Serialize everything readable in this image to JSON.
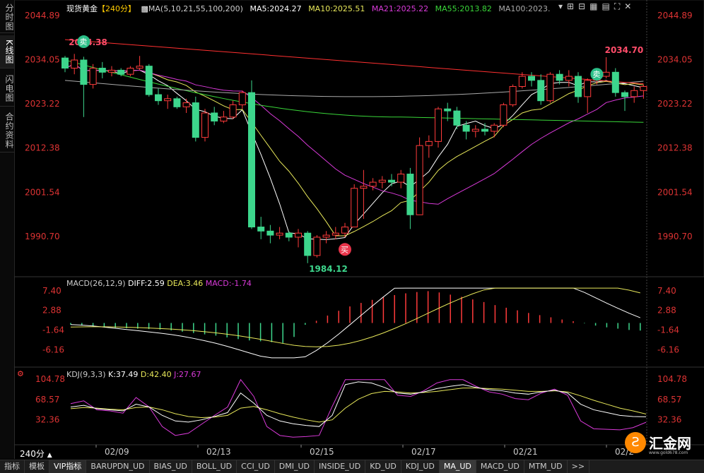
{
  "sidebar": {
    "tabs": [
      {
        "label": "分时图",
        "active": false
      },
      {
        "label": "K线图",
        "active": true
      },
      {
        "label": "闪电图",
        "active": false
      },
      {
        "label": "合约资料",
        "active": false
      }
    ]
  },
  "main_panel": {
    "symbol": "现货黄金",
    "period": "【240分】",
    "ma_spec": "MA(5,10,21,55,100,200)",
    "ma5": "MA5:2024.27",
    "ma10": "MA10:2025.51",
    "ma21": "MA21:2025.22",
    "ma55": "MA55:2013.82",
    "ma100": "MA100:2023.",
    "y_ticks": [
      "2044.89",
      "2034.05",
      "2023.22",
      "2012.38",
      "2001.54",
      "1990.70"
    ],
    "high_label": "2034.70",
    "high_label_left": "2034.38",
    "low_label": "1984.12",
    "sell_badge": "卖",
    "buy_badge": "买"
  },
  "macd_panel": {
    "title": "MACD(26,12,9)",
    "diff": "DIFF:2.59",
    "dea": "DEA:3.46",
    "macd": "MACD:-1.74",
    "y_ticks": [
      "7.40",
      "2.88",
      "-1.64",
      "-6.16"
    ]
  },
  "kdj_panel": {
    "title": "KDJ(9,3,3)",
    "k": "K:37.49",
    "d": "D:42.40",
    "j": "J:27.67",
    "y_ticks": [
      "104.78",
      "68.57",
      "32.36"
    ]
  },
  "x_axis": {
    "dates": [
      "02/09",
      "02/13",
      "02/15",
      "02/17",
      "02/21",
      "02/2"
    ]
  },
  "period_badge": "240分",
  "bottom_tabs": [
    "指标",
    "模板",
    "VIP指标",
    "BARUPDN_UD",
    "BIAS_UD",
    "BOLL_UD",
    "CCI_UD",
    "DMI_UD",
    "INSIDE_UD",
    "KD_UD",
    "KDJ_UD",
    "MA_UD",
    "MACD_UD",
    "MTM_UD",
    ">>"
  ],
  "active_bottom_tab": "MA_UD",
  "logo": {
    "text": "汇金网",
    "subtext": "www.gold678.com"
  },
  "colors": {
    "up": "#ff3b3b",
    "down": "#3dd68c",
    "ma5": "#ffffff",
    "ma10": "#e8e85a",
    "ma21": "#d93ad9",
    "ma55": "#39d639",
    "ma100": "#aaaaaa",
    "ma200": "#ff3030"
  },
  "chart_data": {
    "type": "candlestick",
    "y_range": [
      1984.12,
      2044.89
    ],
    "candles": [
      [
        2034.5,
        2035.0,
        2031.0,
        2032.0
      ],
      [
        2032.0,
        2035.5,
        2030.5,
        2034.0
      ],
      [
        2034.0,
        2034.8,
        2020.0,
        2028.0
      ],
      [
        2028.0,
        2033.0,
        2027.0,
        2032.0
      ],
      [
        2032.0,
        2033.5,
        2029.5,
        2031.0
      ],
      [
        2031.0,
        2032.5,
        2030.0,
        2031.5
      ],
      [
        2031.5,
        2032.0,
        2030.0,
        2030.5
      ],
      [
        2030.5,
        2032.5,
        2030.0,
        2032.0
      ],
      [
        2032.0,
        2035.0,
        2031.5,
        2032.5
      ],
      [
        2032.5,
        2033.0,
        2025.0,
        2025.5
      ],
      [
        2025.5,
        2027.0,
        2023.0,
        2024.0
      ],
      [
        2024.0,
        2025.5,
        2022.0,
        2024.5
      ],
      [
        2024.5,
        2025.0,
        2022.0,
        2022.5
      ],
      [
        2022.5,
        2024.5,
        2021.0,
        2023.5
      ],
      [
        2023.5,
        2025.0,
        2014.0,
        2015.0
      ],
      [
        2015.0,
        2022.0,
        2014.0,
        2021.0
      ],
      [
        2021.0,
        2022.5,
        2018.0,
        2019.0
      ],
      [
        2019.0,
        2021.5,
        2018.5,
        2020.0
      ],
      [
        2020.0,
        2024.0,
        2019.5,
        2023.0
      ],
      [
        2023.0,
        2026.5,
        2022.0,
        2026.0
      ],
      [
        2026.0,
        2029.0,
        1992.5,
        1993.0
      ],
      [
        1993.0,
        1995.5,
        1990.0,
        1992.0
      ],
      [
        1992.0,
        1993.5,
        1989.0,
        1991.0
      ],
      [
        1991.0,
        1993.0,
        1990.0,
        1991.5
      ],
      [
        1991.5,
        1992.0,
        1989.5,
        1990.5
      ],
      [
        1990.5,
        1992.5,
        1988.0,
        1991.5
      ],
      [
        1991.5,
        1992.0,
        1984.12,
        1986.0
      ],
      [
        1986.0,
        1991.0,
        1985.5,
        1990.5
      ],
      [
        1990.5,
        1992.0,
        1989.0,
        1991.0
      ],
      [
        1991.0,
        1993.0,
        1990.0,
        1991.5
      ],
      [
        1991.5,
        1994.0,
        1990.5,
        1993.0
      ],
      [
        1993.0,
        2003.5,
        1993.0,
        2002.5
      ],
      [
        2002.5,
        2007.0,
        1995.0,
        2003.0
      ],
      [
        2003.0,
        2005.0,
        2002.0,
        2004.0
      ],
      [
        2004.0,
        2005.5,
        2002.5,
        2004.5
      ],
      [
        2004.5,
        2006.0,
        2003.0,
        2004.0
      ],
      [
        2004.0,
        2007.0,
        2002.5,
        2006.0
      ],
      [
        2006.0,
        2007.5,
        1992.5,
        1996.0
      ],
      [
        1996.0,
        2015.0,
        1996.0,
        2013.0
      ],
      [
        2013.0,
        2015.5,
        2010.0,
        2014.0
      ],
      [
        2014.0,
        2022.5,
        2012.5,
        2022.0
      ],
      [
        2022.0,
        2023.5,
        2019.0,
        2021.5
      ],
      [
        2021.5,
        2022.5,
        2017.0,
        2018.0
      ],
      [
        2018.0,
        2019.0,
        2014.5,
        2016.5
      ],
      [
        2016.5,
        2018.0,
        2015.0,
        2017.0
      ],
      [
        2017.0,
        2018.5,
        2015.5,
        2016.5
      ],
      [
        2016.5,
        2018.5,
        2015.0,
        2018.0
      ],
      [
        2018.0,
        2023.5,
        2017.5,
        2023.0
      ],
      [
        2023.0,
        2028.0,
        2022.5,
        2027.5
      ],
      [
        2027.5,
        2031.0,
        2027.0,
        2030.0
      ],
      [
        2030.0,
        2031.0,
        2027.5,
        2029.0
      ],
      [
        2029.0,
        2030.5,
        2023.0,
        2024.0
      ],
      [
        2024.0,
        2031.0,
        2023.5,
        2030.5
      ],
      [
        2030.5,
        2031.5,
        2028.0,
        2029.0
      ],
      [
        2029.0,
        2031.5,
        2027.5,
        2030.0
      ],
      [
        2030.0,
        2031.0,
        2023.5,
        2025.0
      ],
      [
        2025.0,
        2029.5,
        2021.0,
        2029.0
      ],
      [
        2029.0,
        2030.5,
        2028.0,
        2030.0
      ],
      [
        2030.0,
        2034.7,
        2029.5,
        2031.0
      ],
      [
        2031.0,
        2032.0,
        2025.0,
        2026.0
      ],
      [
        2026.0,
        2026.5,
        2021.5,
        2025.0
      ],
      [
        2025.0,
        2027.5,
        2023.5,
        2026.5
      ],
      [
        2026.5,
        2028.0,
        2024.5,
        2027.5
      ]
    ],
    "macd_hist": [
      -0.4,
      -0.6,
      -0.8,
      -1.0,
      -1.1,
      -1.2,
      -1.3,
      -1.4,
      -1.5,
      -1.7,
      -2.0,
      -2.3,
      -2.6,
      -2.9,
      -3.3,
      -3.7,
      -4.0,
      -4.2,
      -4.4,
      -4.6,
      -3.2,
      -0.4,
      0.5,
      1.7,
      2.8,
      3.8,
      4.6,
      5.3,
      5.9,
      6.4,
      6.8,
      7.1,
      7.3,
      7.0,
      6.5,
      6.0,
      5.4,
      4.8,
      4.1,
      3.5,
      2.9,
      2.3,
      1.8,
      1.3,
      0.8,
      0.4,
      -0.1,
      -0.6,
      -1.0,
      -1.3,
      -1.6,
      -1.74
    ],
    "k_values": [
      55,
      58,
      52,
      50,
      48,
      60,
      55,
      40,
      30,
      28,
      32,
      38,
      45,
      80,
      62,
      40,
      30,
      25,
      22,
      20,
      40,
      95,
      100,
      98,
      90,
      80,
      78,
      82,
      88,
      92,
      95,
      90,
      86,
      84,
      80,
      78,
      82,
      85,
      80,
      60,
      50,
      45,
      40,
      38,
      37.49
    ],
    "d_values": [
      52,
      54,
      53,
      51,
      50,
      54,
      55,
      50,
      43,
      38,
      36,
      37,
      40,
      53,
      56,
      50,
      43,
      37,
      32,
      28,
      32,
      53,
      69,
      79,
      83,
      82,
      80,
      81,
      83,
      86,
      89,
      89,
      88,
      87,
      85,
      83,
      83,
      84,
      82,
      75,
      67,
      60,
      53,
      48,
      42.4
    ],
    "j_values": [
      61,
      66,
      50,
      48,
      44,
      72,
      55,
      20,
      4,
      8,
      24,
      40,
      55,
      104,
      74,
      20,
      4,
      1,
      2,
      4,
      56,
      104,
      104,
      104,
      104,
      76,
      74,
      84,
      98,
      104,
      104,
      92,
      82,
      78,
      70,
      68,
      80,
      87,
      76,
      30,
      16,
      15,
      14,
      18,
      27.67
    ]
  }
}
